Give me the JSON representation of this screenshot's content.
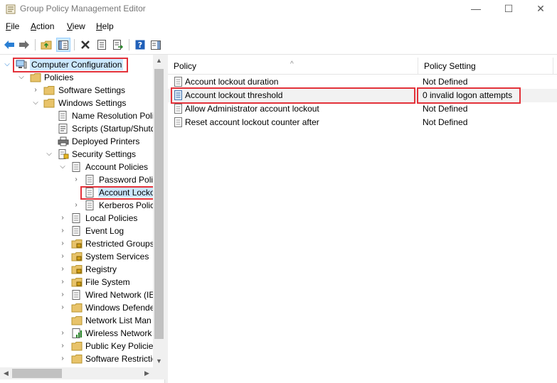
{
  "window": {
    "title": "Group Policy Management Editor",
    "controls": {
      "minimize": "—",
      "maximize": "☐",
      "close": "✕"
    }
  },
  "menu": {
    "items": [
      {
        "label": "File",
        "accel": "F",
        "rest": "ile"
      },
      {
        "label": "Action",
        "accel": "A",
        "rest": "ction"
      },
      {
        "label": "View",
        "accel": "V",
        "rest": "iew"
      },
      {
        "label": "Help",
        "accel": "H",
        "rest": "elp"
      }
    ]
  },
  "toolbar": {
    "buttons": [
      "back-icon",
      "forward-icon",
      "up-folder-icon",
      "show-hide-tree-icon",
      "delete-icon",
      "properties-icon",
      "export-list-icon",
      "help-icon",
      "show-action-pane-icon"
    ]
  },
  "tree": {
    "computer_configuration": "Computer Configuration",
    "policies": "Policies",
    "software_settings": "Software Settings",
    "windows_settings": "Windows Settings",
    "name_resolution_policy": "Name Resolution Poli",
    "scripts": "Scripts (Startup/Shutd",
    "deployed_printers": "Deployed Printers",
    "security_settings": "Security Settings",
    "account_policies": "Account Policies",
    "password_policy": "Password Polic",
    "account_lockout_policy": "Account Locko",
    "kerberos_policy": "Kerberos Polic",
    "local_policies": "Local Policies",
    "event_log": "Event Log",
    "restricted_groups": "Restricted Groups",
    "system_services": "System Services",
    "registry": "Registry",
    "file_system": "File System",
    "wired_network": "Wired Network (IE",
    "windows_defender": "Windows Defende",
    "network_list_manager": "Network List Man",
    "wireless_network": "Wireless Network",
    "public_key_policies": "Public Key Policie",
    "software_restriction": "Software Restrictic"
  },
  "list": {
    "columns": {
      "policy": "Policy",
      "setting": "Policy Setting"
    },
    "rows": [
      {
        "policy": "Account lockout duration",
        "setting": "Not Defined"
      },
      {
        "policy": "Account lockout threshold",
        "setting": "0 invalid logon attempts"
      },
      {
        "policy": "Allow Administrator account lockout",
        "setting": "Not Defined"
      },
      {
        "policy": "Reset account lockout counter after",
        "setting": "Not Defined"
      }
    ]
  },
  "colors": {
    "highlight": "#e3323a",
    "selection": "#cce8ff",
    "folder": "#e8c36a"
  }
}
